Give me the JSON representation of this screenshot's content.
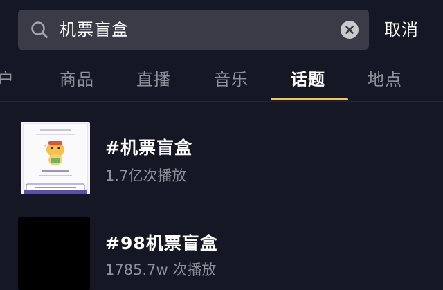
{
  "search": {
    "query": "机票盲盒",
    "cancel_label": "取消"
  },
  "tabs": [
    {
      "label": "户"
    },
    {
      "label": "商品"
    },
    {
      "label": "直播"
    },
    {
      "label": "音乐"
    },
    {
      "label": "话题",
      "active": true
    },
    {
      "label": "地点"
    }
  ],
  "results": [
    {
      "title": "#机票盲盒",
      "views": "1.7亿次播放"
    },
    {
      "title": "#98机票盲盒",
      "views": "1785.7w 次播放"
    }
  ],
  "colors": {
    "background": "#161724",
    "search_box": "#3a3b46",
    "accent_indicator": "#f1c95a",
    "inactive_text": "#8f909a"
  }
}
